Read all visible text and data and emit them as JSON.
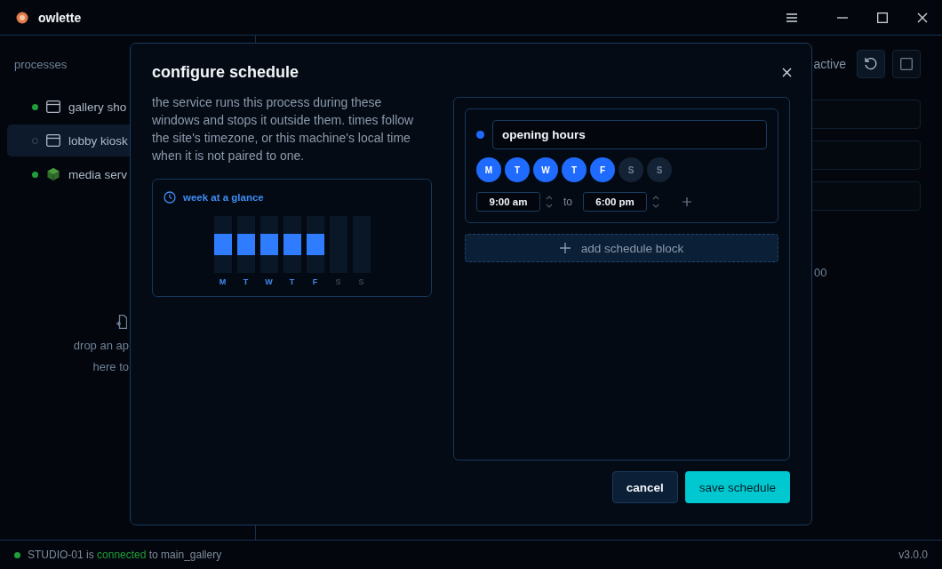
{
  "app": {
    "name": "owlette"
  },
  "sidebar": {
    "title": "processes",
    "items": [
      {
        "label": "gallery sho",
        "running": true,
        "selected": false,
        "kind": "window"
      },
      {
        "label": "lobby kiosk",
        "running": false,
        "selected": true,
        "kind": "window"
      },
      {
        "label": "media serv",
        "running": true,
        "selected": false,
        "kind": "cube"
      }
    ],
    "drop_hint": [
      "drop an ap",
      "here to"
    ]
  },
  "main": {
    "status": "active",
    "footer_text": "00"
  },
  "dialog": {
    "title": "configure schedule",
    "description": "the service runs this process during these windows and stops it outside them. times follow the site's timezone, or this machine's local time when it is not paired to one.",
    "glance": {
      "title": "week at a glance",
      "days": [
        {
          "label": "M",
          "active": true
        },
        {
          "label": "T",
          "active": true
        },
        {
          "label": "W",
          "active": true
        },
        {
          "label": "T",
          "active": true
        },
        {
          "label": "F",
          "active": true
        },
        {
          "label": "S",
          "active": false
        },
        {
          "label": "S",
          "active": false
        }
      ]
    },
    "blocks": [
      {
        "name": "opening hours",
        "color": "#1f6bff",
        "days": [
          {
            "label": "M",
            "selected": true
          },
          {
            "label": "T",
            "selected": true
          },
          {
            "label": "W",
            "selected": true
          },
          {
            "label": "T",
            "selected": true
          },
          {
            "label": "F",
            "selected": true
          },
          {
            "label": "S",
            "selected": false
          },
          {
            "label": "S",
            "selected": false
          }
        ],
        "ranges": [
          {
            "start": "9:00 am",
            "separator": "to",
            "end": "6:00 pm"
          }
        ]
      }
    ],
    "add_block": "add schedule block",
    "cancel": "cancel",
    "save": "save schedule"
  },
  "status_bar": {
    "parts": [
      {
        "text": "STUDIO-01",
        "kind": "plain"
      },
      {
        "text": "is",
        "kind": "plain"
      },
      {
        "text": "connected",
        "kind": "ok"
      },
      {
        "text": "to main_gallery",
        "kind": "plain"
      }
    ],
    "connected": true,
    "version": "v3.0.0"
  }
}
